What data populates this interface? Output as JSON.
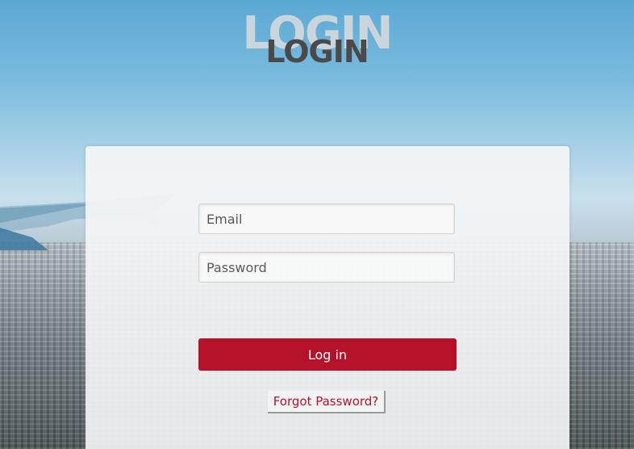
{
  "header": {
    "title_ghost": "LOGIN",
    "title": "LOGIN"
  },
  "form": {
    "email_placeholder": "Email",
    "password_placeholder": "Password",
    "login_label": "Log in",
    "forgot_label": "Forgot Password?"
  },
  "colors": {
    "accent": "#b5122a",
    "title_text": "#4a4a4a"
  },
  "background": {
    "icon": "airplane-wing-icon"
  }
}
